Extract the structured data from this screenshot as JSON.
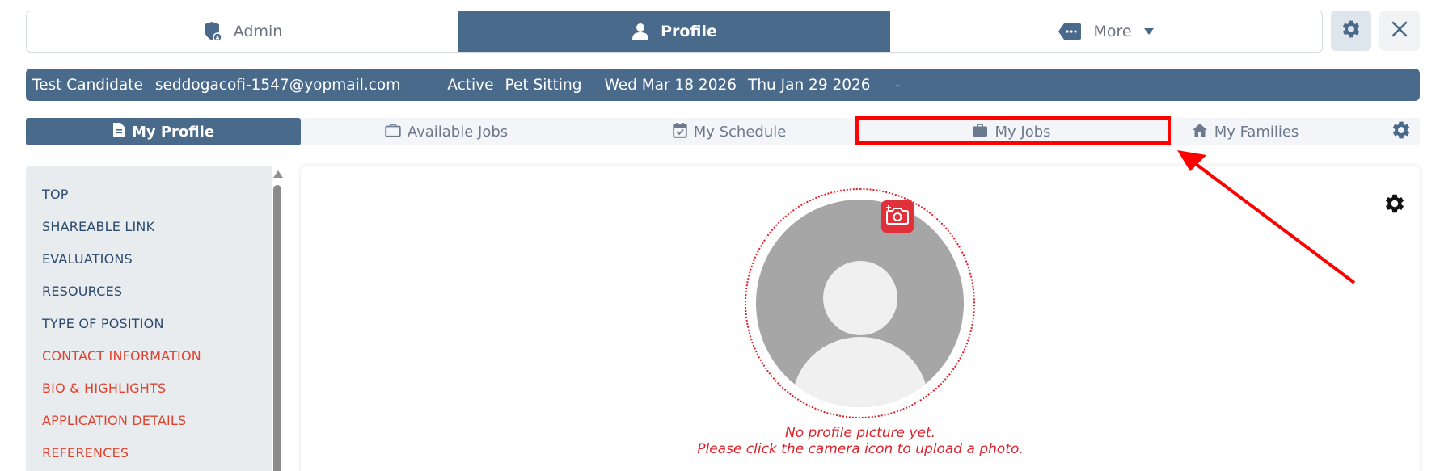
{
  "top_tabs": {
    "admin_label": "Admin",
    "profile_label": "Profile",
    "more_label": "More"
  },
  "info_bar": {
    "name": "Test Candidate",
    "email": "seddogacofi-1547@yopmail.com",
    "status": "Active",
    "service": "Pet Sitting",
    "date1": "Wed Mar 18 2026",
    "date2": "Thu Jan 29 2026",
    "dash": "-"
  },
  "sub_nav": {
    "my_profile": "My Profile",
    "available_jobs": "Available Jobs",
    "my_schedule": "My Schedule",
    "my_jobs": "My Jobs",
    "my_families": "My Families"
  },
  "sidebar": {
    "items": [
      {
        "label": "TOP",
        "color": "#2c4a6e"
      },
      {
        "label": "SHAREABLE LINK",
        "color": "#2c4a6e"
      },
      {
        "label": "EVALUATIONS",
        "color": "#2c4a6e"
      },
      {
        "label": "RESOURCES",
        "color": "#2c4a6e"
      },
      {
        "label": "TYPE OF POSITION",
        "color": "#2c4a6e"
      },
      {
        "label": "CONTACT INFORMATION",
        "color": "#e0412c"
      },
      {
        "label": "BIO & HIGHLIGHTS",
        "color": "#e0412c"
      },
      {
        "label": "APPLICATION DETAILS",
        "color": "#e0412c"
      },
      {
        "label": "REFERENCES",
        "color": "#e0412c"
      }
    ]
  },
  "profile_picture": {
    "message_line1": "No profile picture yet.",
    "message_line2": "Please click the camera icon to upload a photo."
  },
  "colors": {
    "primary": "#4a6a8c",
    "alert": "#e0202a",
    "annotation": "#ff0000"
  }
}
